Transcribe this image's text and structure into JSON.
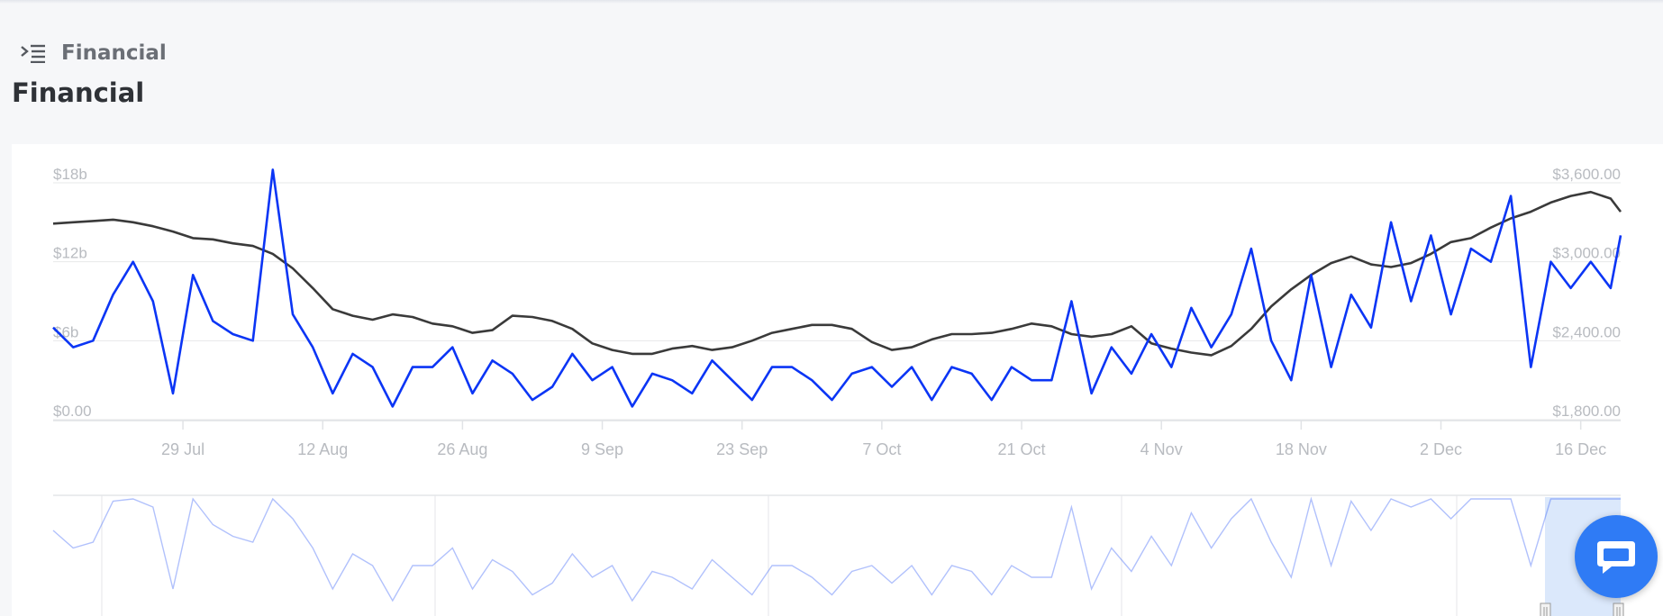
{
  "breadcrumb": {
    "label": "Financial"
  },
  "page": {
    "title": "Financial"
  },
  "icons": {
    "menu": "indent-menu-icon",
    "chat": "chat-bubble-icon"
  },
  "colors": {
    "series_dark": "#3a3a3a",
    "series_blue": "#0b35f5",
    "grid": "#e7e8ea",
    "tick": "#b8bbc0"
  },
  "chart_data": {
    "type": "line",
    "title": "",
    "grid": true,
    "legend": "none",
    "x_ticks": [
      "29 Jul",
      "12 Aug",
      "26 Aug",
      "9 Sep",
      "23 Sep",
      "7 Oct",
      "21 Oct",
      "4 Nov",
      "18 Nov",
      "2 Dec",
      "16 Dec"
    ],
    "y_left": {
      "ticks": [
        "$0.00",
        "$6b",
        "$12b",
        "$18b"
      ],
      "range": [
        0,
        18
      ]
    },
    "y_right": {
      "ticks": [
        "$1,800.00",
        "$2,400.00",
        "$3,000.00",
        "$3,600.00"
      ],
      "range": [
        1800,
        3600
      ]
    },
    "x_range": [
      "16 Jul",
      "20 Dec"
    ],
    "series": [
      {
        "axis": "right",
        "color": "#3a3a3a",
        "x": [
          "16 Jul",
          "18 Jul",
          "20 Jul",
          "22 Jul",
          "24 Jul",
          "26 Jul",
          "28 Jul",
          "30 Jul",
          "1 Aug",
          "3 Aug",
          "5 Aug",
          "7 Aug",
          "9 Aug",
          "11 Aug",
          "13 Aug",
          "15 Aug",
          "17 Aug",
          "19 Aug",
          "21 Aug",
          "23 Aug",
          "25 Aug",
          "27 Aug",
          "29 Aug",
          "31 Aug",
          "2 Sep",
          "4 Sep",
          "6 Sep",
          "8 Sep",
          "10 Sep",
          "12 Sep",
          "14 Sep",
          "16 Sep",
          "18 Sep",
          "20 Sep",
          "22 Sep",
          "24 Sep",
          "26 Sep",
          "28 Sep",
          "30 Sep",
          "2 Oct",
          "4 Oct",
          "6 Oct",
          "8 Oct",
          "10 Oct",
          "12 Oct",
          "14 Oct",
          "16 Oct",
          "18 Oct",
          "20 Oct",
          "22 Oct",
          "24 Oct",
          "26 Oct",
          "28 Oct",
          "30 Oct",
          "1 Nov",
          "3 Nov",
          "5 Nov",
          "7 Nov",
          "9 Nov",
          "11 Nov",
          "13 Nov",
          "15 Nov",
          "17 Nov",
          "19 Nov",
          "21 Nov",
          "23 Nov",
          "25 Nov",
          "27 Nov",
          "29 Nov",
          "1 Dec",
          "3 Dec",
          "5 Dec",
          "7 Dec",
          "9 Dec",
          "11 Dec",
          "13 Dec",
          "15 Dec",
          "17 Dec",
          "19 Dec",
          "20 Dec"
        ],
        "y": [
          3290,
          3300,
          3310,
          3320,
          3300,
          3270,
          3230,
          3180,
          3170,
          3140,
          3120,
          3060,
          2950,
          2800,
          2640,
          2590,
          2560,
          2600,
          2580,
          2530,
          2510,
          2460,
          2480,
          2590,
          2580,
          2550,
          2490,
          2380,
          2330,
          2300,
          2300,
          2340,
          2360,
          2330,
          2350,
          2400,
          2460,
          2490,
          2520,
          2520,
          2490,
          2390,
          2330,
          2350,
          2410,
          2450,
          2450,
          2460,
          2490,
          2530,
          2510,
          2450,
          2430,
          2450,
          2510,
          2380,
          2340,
          2310,
          2290,
          2360,
          2490,
          2660,
          2790,
          2900,
          2990,
          3040,
          2980,
          2960,
          2990,
          3060,
          3150,
          3180,
          3260,
          3330,
          3380,
          3450,
          3500,
          3530,
          3480,
          3380
        ]
      },
      {
        "axis": "left",
        "color": "#0b35f5",
        "x": [
          "16 Jul",
          "18 Jul",
          "20 Jul",
          "22 Jul",
          "24 Jul",
          "26 Jul",
          "28 Jul",
          "30 Jul",
          "1 Aug",
          "3 Aug",
          "5 Aug",
          "7 Aug",
          "9 Aug",
          "11 Aug",
          "13 Aug",
          "15 Aug",
          "17 Aug",
          "19 Aug",
          "21 Aug",
          "23 Aug",
          "25 Aug",
          "27 Aug",
          "29 Aug",
          "31 Aug",
          "2 Sep",
          "4 Sep",
          "6 Sep",
          "8 Sep",
          "10 Sep",
          "12 Sep",
          "14 Sep",
          "16 Sep",
          "18 Sep",
          "20 Sep",
          "22 Sep",
          "24 Sep",
          "26 Sep",
          "28 Sep",
          "30 Sep",
          "2 Oct",
          "4 Oct",
          "6 Oct",
          "8 Oct",
          "10 Oct",
          "12 Oct",
          "14 Oct",
          "16 Oct",
          "18 Oct",
          "20 Oct",
          "22 Oct",
          "24 Oct",
          "26 Oct",
          "28 Oct",
          "30 Oct",
          "1 Nov",
          "3 Nov",
          "5 Nov",
          "7 Nov",
          "9 Nov",
          "11 Nov",
          "13 Nov",
          "15 Nov",
          "17 Nov",
          "19 Nov",
          "21 Nov",
          "23 Nov",
          "25 Nov",
          "27 Nov",
          "29 Nov",
          "1 Dec",
          "3 Dec",
          "5 Dec",
          "7 Dec",
          "9 Dec",
          "11 Dec",
          "13 Dec",
          "15 Dec",
          "17 Dec",
          "19 Dec",
          "20 Dec"
        ],
        "y": [
          7,
          5.5,
          6,
          9.5,
          12,
          9,
          2,
          11,
          7.5,
          6.5,
          6,
          19,
          8,
          5.5,
          2,
          5,
          4,
          1,
          4,
          4,
          5.5,
          2,
          4.5,
          3.5,
          1.5,
          2.5,
          5,
          3,
          4,
          1,
          3.5,
          3,
          2,
          4.5,
          3,
          1.5,
          4,
          4,
          3,
          1.5,
          3.5,
          4,
          2.5,
          4,
          1.5,
          4,
          3.5,
          1.5,
          4,
          3,
          3,
          9,
          2,
          5.5,
          3.5,
          6.5,
          4,
          8.5,
          5.5,
          8,
          13,
          6,
          3,
          11,
          4,
          9.5,
          7,
          15,
          9,
          14,
          8,
          13,
          12,
          17,
          4,
          12,
          10,
          12,
          10,
          14
        ]
      }
    ]
  }
}
